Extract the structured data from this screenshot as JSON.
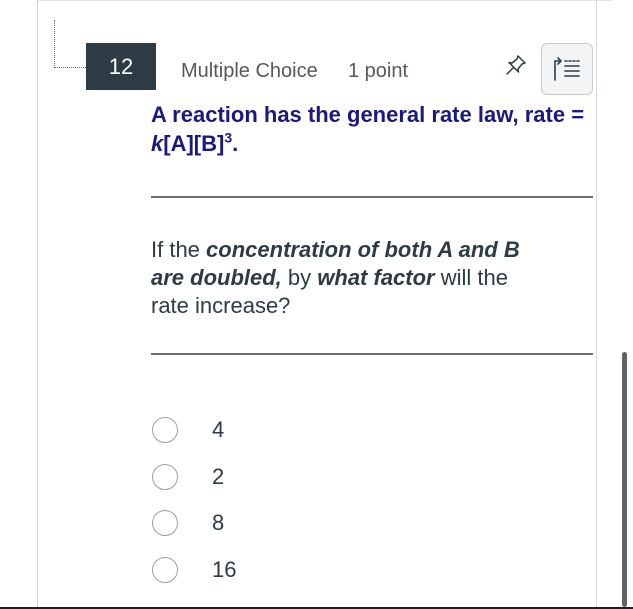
{
  "question": {
    "number": "12",
    "type": "Multiple Choice",
    "points": "1 point",
    "title": {
      "prefix": "A reaction has the general rate law, rate = ",
      "k": "k",
      "rest": "[A][B]",
      "exponent": "3",
      "suffix": "."
    },
    "body": {
      "t1": "If the ",
      "b1": "concentration of both A and B are doubled,",
      "t2": " by ",
      "b2": "what factor",
      "t3": " will the rate increase?"
    },
    "options": [
      {
        "label": "4",
        "selected": false
      },
      {
        "label": "2",
        "selected": false
      },
      {
        "label": "8",
        "selected": false
      },
      {
        "label": "16",
        "selected": false
      }
    ]
  },
  "icons": {
    "pin": "pin-icon",
    "list": "question-list-icon"
  },
  "colors": {
    "number_badge": "#2d3b45",
    "title": "#1a1a7e",
    "text": "#2d3b45",
    "muted": "#55595e"
  }
}
